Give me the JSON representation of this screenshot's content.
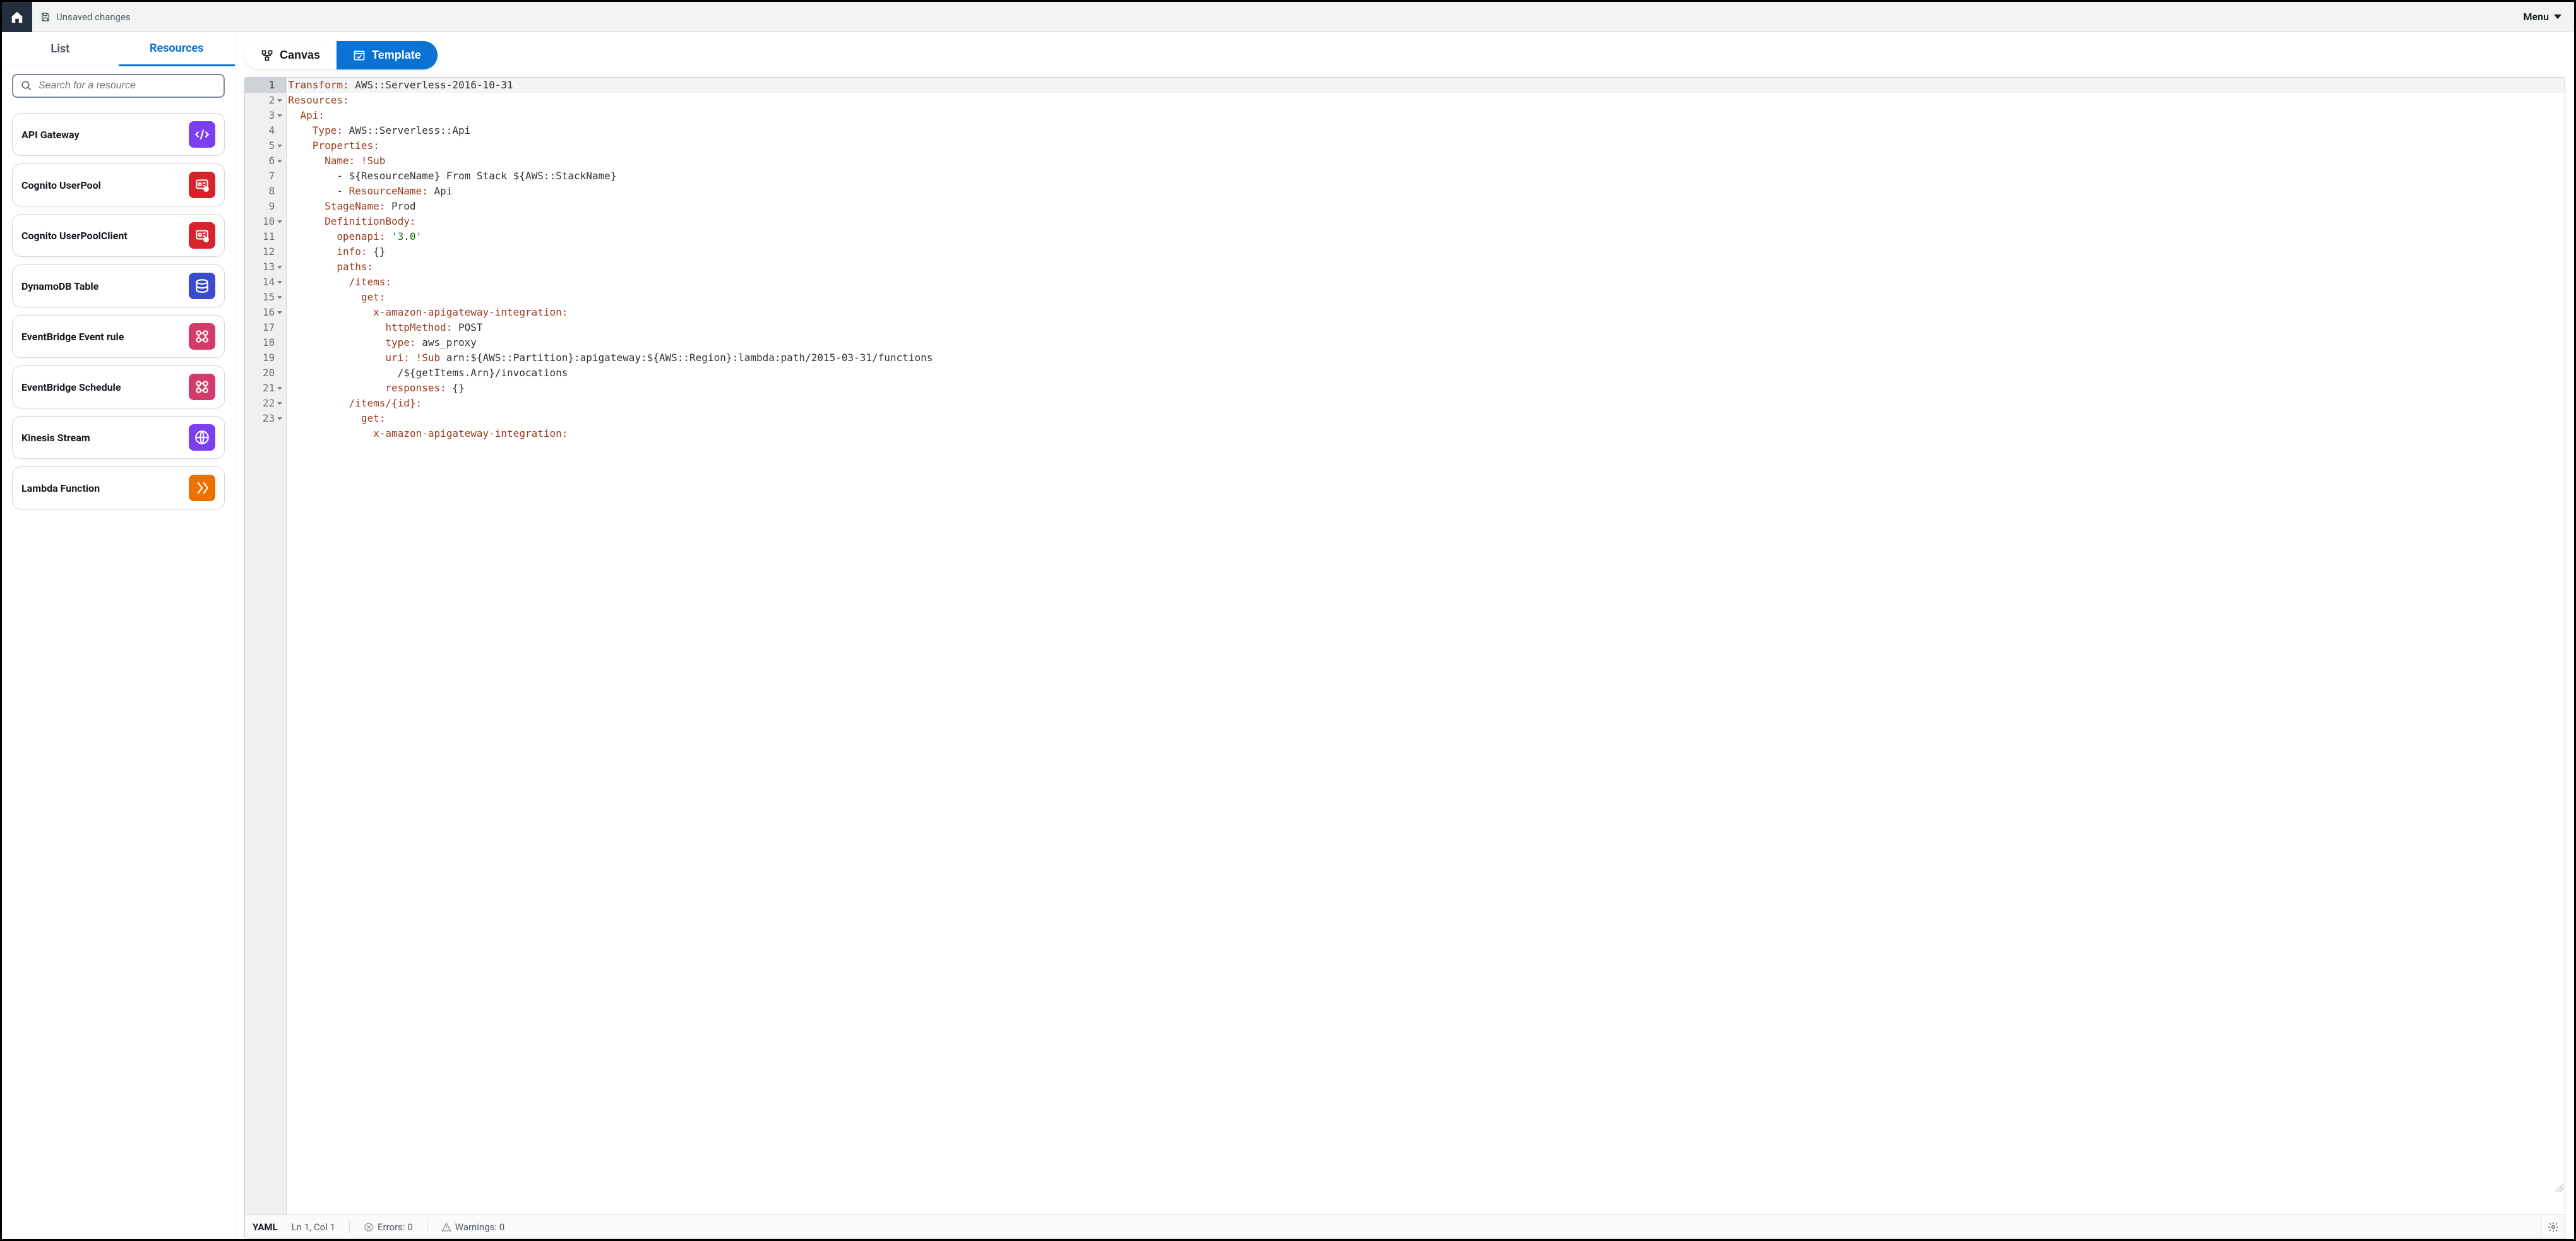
{
  "header": {
    "unsaved_label": "Unsaved changes",
    "menu_label": "Menu"
  },
  "sidebar": {
    "tabs": {
      "list": "List",
      "resources": "Resources"
    },
    "search_placeholder": "Search for a resource",
    "items": [
      {
        "label": "API Gateway",
        "color": "#7b3ff2"
      },
      {
        "label": "Cognito UserPool",
        "color": "#d6242c"
      },
      {
        "label": "Cognito UserPoolClient",
        "color": "#d6242c"
      },
      {
        "label": "DynamoDB Table",
        "color": "#3b4cca"
      },
      {
        "label": "EventBridge Event rule",
        "color": "#d33b6a"
      },
      {
        "label": "EventBridge Schedule",
        "color": "#d33b6a"
      },
      {
        "label": "Kinesis Stream",
        "color": "#7b3ff2"
      },
      {
        "label": "Lambda Function",
        "color": "#ed7100"
      }
    ]
  },
  "main": {
    "view_tabs": {
      "canvas": "Canvas",
      "template": "Template"
    }
  },
  "editor": {
    "lines": [
      {
        "n": 1,
        "fold": false,
        "tokens": [
          [
            "k",
            "Transform:"
          ],
          [
            "v",
            " AWS::Serverless-2016-10-31"
          ]
        ]
      },
      {
        "n": 2,
        "fold": true,
        "tokens": [
          [
            "k",
            "Resources:"
          ]
        ]
      },
      {
        "n": 3,
        "fold": true,
        "tokens": [
          [
            "v",
            "  "
          ],
          [
            "k",
            "Api:"
          ]
        ]
      },
      {
        "n": 4,
        "fold": false,
        "tokens": [
          [
            "v",
            "    "
          ],
          [
            "k",
            "Type:"
          ],
          [
            "v",
            " AWS::Serverless::Api"
          ]
        ]
      },
      {
        "n": 5,
        "fold": true,
        "tokens": [
          [
            "v",
            "    "
          ],
          [
            "k",
            "Properties:"
          ]
        ]
      },
      {
        "n": 6,
        "fold": true,
        "tokens": [
          [
            "v",
            "      "
          ],
          [
            "k",
            "Name:"
          ],
          [
            "v",
            " "
          ],
          [
            "t",
            "!Sub"
          ]
        ]
      },
      {
        "n": 7,
        "fold": false,
        "tokens": [
          [
            "v",
            "        - ${ResourceName} From Stack ${AWS::StackName}"
          ]
        ]
      },
      {
        "n": 8,
        "fold": false,
        "tokens": [
          [
            "v",
            "        - "
          ],
          [
            "k",
            "ResourceName:"
          ],
          [
            "v",
            " Api"
          ]
        ]
      },
      {
        "n": 9,
        "fold": false,
        "tokens": [
          [
            "v",
            "      "
          ],
          [
            "k",
            "StageName:"
          ],
          [
            "v",
            " Prod"
          ]
        ]
      },
      {
        "n": 10,
        "fold": true,
        "tokens": [
          [
            "v",
            "      "
          ],
          [
            "k",
            "DefinitionBody:"
          ]
        ]
      },
      {
        "n": 11,
        "fold": false,
        "tokens": [
          [
            "v",
            "        "
          ],
          [
            "k",
            "openapi:"
          ],
          [
            "v",
            " "
          ],
          [
            "s",
            "'3.0'"
          ]
        ]
      },
      {
        "n": 12,
        "fold": false,
        "tokens": [
          [
            "v",
            "        "
          ],
          [
            "k",
            "info:"
          ],
          [
            "v",
            " {}"
          ]
        ]
      },
      {
        "n": 13,
        "fold": true,
        "tokens": [
          [
            "v",
            "        "
          ],
          [
            "k",
            "paths:"
          ]
        ]
      },
      {
        "n": 14,
        "fold": true,
        "tokens": [
          [
            "v",
            "          "
          ],
          [
            "k",
            "/items:"
          ]
        ]
      },
      {
        "n": 15,
        "fold": true,
        "tokens": [
          [
            "v",
            "            "
          ],
          [
            "k",
            "get:"
          ]
        ]
      },
      {
        "n": 16,
        "fold": true,
        "tokens": [
          [
            "v",
            "              "
          ],
          [
            "k",
            "x-amazon-apigateway-integration:"
          ]
        ]
      },
      {
        "n": 17,
        "fold": false,
        "tokens": [
          [
            "v",
            "                "
          ],
          [
            "k",
            "httpMethod:"
          ],
          [
            "v",
            " POST"
          ]
        ]
      },
      {
        "n": 18,
        "fold": false,
        "tokens": [
          [
            "v",
            "                "
          ],
          [
            "k",
            "type:"
          ],
          [
            "v",
            " aws_proxy"
          ]
        ]
      },
      {
        "n": 19,
        "fold": false,
        "tokens": [
          [
            "v",
            "                "
          ],
          [
            "k",
            "uri:"
          ],
          [
            "v",
            " "
          ],
          [
            "t",
            "!Sub"
          ],
          [
            "v",
            " arn:${AWS::Partition}:apigateway:${AWS::Region}:lambda:path/2015-03-31/functions\n                  /${getItems.Arn}/invocations"
          ]
        ]
      },
      {
        "n": 20,
        "fold": false,
        "tokens": [
          [
            "v",
            "                "
          ],
          [
            "k",
            "responses:"
          ],
          [
            "v",
            " {}"
          ]
        ]
      },
      {
        "n": 21,
        "fold": true,
        "tokens": [
          [
            "v",
            "          "
          ],
          [
            "k",
            "/items/{id}:"
          ]
        ]
      },
      {
        "n": 22,
        "fold": true,
        "tokens": [
          [
            "v",
            "            "
          ],
          [
            "k",
            "get:"
          ]
        ]
      },
      {
        "n": 23,
        "fold": true,
        "tokens": [
          [
            "v",
            "              "
          ],
          [
            "k",
            "x-amazon-apigateway-integration:"
          ]
        ]
      }
    ]
  },
  "status": {
    "lang": "YAML",
    "position": "Ln 1, Col 1",
    "errors_label": "Errors: 0",
    "warnings_label": "Warnings: 0"
  }
}
